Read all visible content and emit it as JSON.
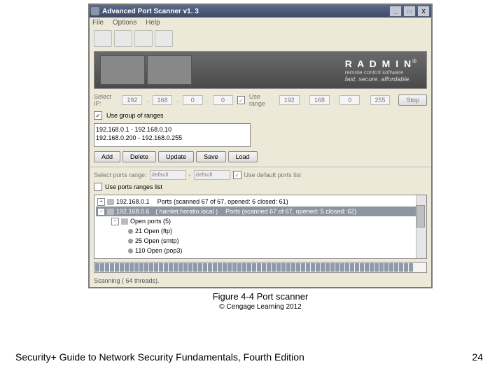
{
  "window": {
    "title": "Advanced Port Scanner v1. 3",
    "menu": {
      "file": "File",
      "options": "Options",
      "help": "Help"
    },
    "win_controls": {
      "min": "_",
      "max": "□",
      "close": "X"
    }
  },
  "banner": {
    "name": "R A D M I N",
    "reg": "®",
    "sub": "remote control software",
    "tag": "fast. secure. affordable."
  },
  "ip": {
    "label": "Select IP:",
    "a1": "192",
    "a2": "168",
    "a3": "0",
    "a4": "0",
    "use_range": "Use range",
    "b1": "192",
    "b2": "168",
    "b3": "0",
    "b4": "255",
    "stop": "Stop"
  },
  "group": {
    "label": "Use group of ranges",
    "line1": "192.168.0.1 - 192.168.0.10",
    "line2": "192.168.0.200 - 192.168.0.255"
  },
  "btns": {
    "add": "Add",
    "del": "Delete",
    "upd": "Update",
    "save": "Save",
    "load": "Load"
  },
  "ports": {
    "label": "Select ports range:",
    "val": "default",
    "use_default": "Use default ports list",
    "use_ranges": "Use ports ranges list"
  },
  "tree": {
    "r1_ip": "192.168.0.1",
    "r1_stats": "Ports (scanned 67 of 67, opened: 6 closed: 61)",
    "r2_ip": "192.168.0.6",
    "r2_host": "( hamlet.horatio.local )",
    "r2_stats": "Ports (scanned 67 of 67, opened: 5 closed: 62)",
    "open_header": "Open ports (5)",
    "p1": "21 Open (ftp)",
    "p2": "25 Open (smtp)",
    "p3": "110 Open (pop3)"
  },
  "status": "Scanning ( 64 threads).",
  "caption": "Figure 4-4 Port scanner",
  "copyright": "© Cengage Learning 2012",
  "footer_book": "Security+ Guide to Network Security Fundamentals, Fourth Edition",
  "footer_page": "24"
}
